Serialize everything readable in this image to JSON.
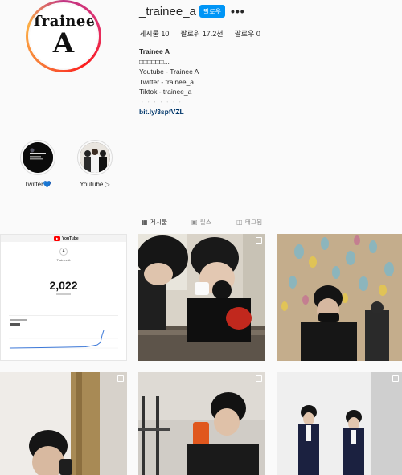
{
  "profile": {
    "username": "_trainee_a",
    "follow_button": "팔로우",
    "more_icon": "more-icon",
    "avatar_logo_line1": "Trainee",
    "avatar_logo_line2": "A"
  },
  "stats": {
    "posts": "게시물 10",
    "followers": "팔로워 17.2천",
    "following": "팔로우 0"
  },
  "bio": {
    "name": "Trainee A",
    "lines": [
      "□□□□□□...",
      "Youtube - Trainee A",
      "Twitter - trainee_a",
      "Tiktok - trainee_a",
      "ᆞᆞᆞᆞᆞᆞᆞ"
    ],
    "link": "bit.ly/3spfVZL"
  },
  "highlights": [
    {
      "label": "Twitter💙"
    },
    {
      "label": "Youtube ▷"
    }
  ],
  "tabs": [
    {
      "label": "게시물",
      "icon": "grid-icon"
    },
    {
      "label": "릴스",
      "icon": "reels-icon"
    },
    {
      "label": "태그됨",
      "icon": "tagged-icon"
    }
  ],
  "posts": {
    "youtube_post": {
      "logo": "YouTube",
      "channel": "Trainee A",
      "subscriber_count": "2,022"
    }
  },
  "colors": {
    "accent": "#0095f6",
    "link": "#00376b",
    "muted": "#8e8e8e",
    "divider": "#dbdbdb"
  }
}
